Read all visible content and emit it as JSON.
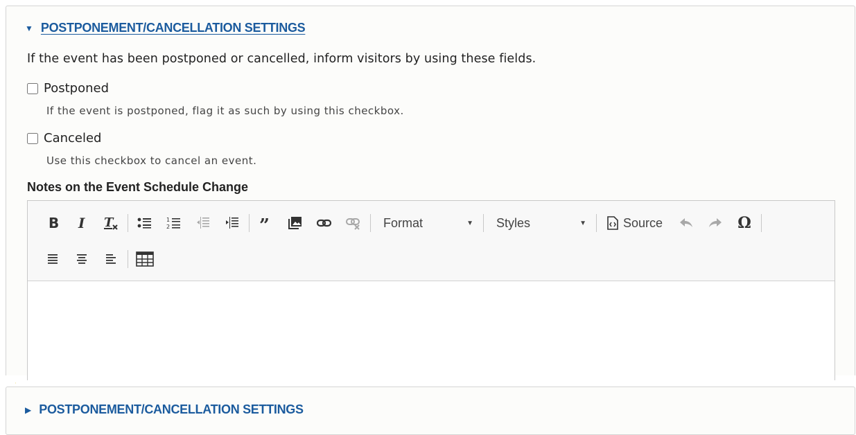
{
  "section": {
    "title": "POSTPONEMENT/CANCELLATION SETTINGS",
    "description": "If the event has been postponed or cancelled, inform visitors by using these fields."
  },
  "postponed": {
    "label": "Postponed",
    "checked": false,
    "help": "If the event is postponed, flag it as such by using this checkbox."
  },
  "canceled": {
    "label": "Canceled",
    "checked": false,
    "help": "Use this checkbox to cancel an event."
  },
  "notes": {
    "label": "Notes on the Event Schedule Change",
    "toolbar": {
      "format_label": "Format",
      "styles_label": "Styles",
      "source_label": "Source",
      "omega_glyph": "Ω"
    }
  },
  "collapsed_section": {
    "title": "POSTPONEMENT/CANCELLATION SETTINGS"
  },
  "colors": {
    "link": "#1b5b9e",
    "toolbar_bg": "#f8f8f8",
    "border": "#d4d4d4"
  }
}
